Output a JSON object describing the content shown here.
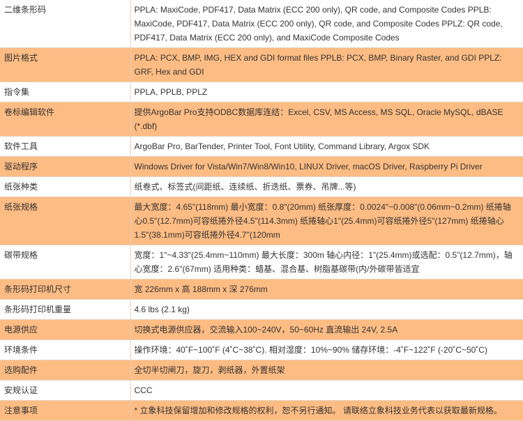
{
  "rows": [
    {
      "label": "二维条形码",
      "value": "PPLA: MaxiCode, PDF417, Data Matrix (ECC 200 only), QR code, and Composite Codes PPLB: MaxiCode, PDF417, Data Matrix (ECC 200 only), QR code, and Composite Codes PPLZ: QR code, PDF417, Data Matrix (ECC 200 only), and MaxiCode Composite Codes"
    },
    {
      "label": "图片格式",
      "value": "PPLA: PCX, BMP, IMG, HEX and GDI format files PPLB: PCX, BMP, Binary Raster, and GDI PPLZ: GRF, Hex and GDI"
    },
    {
      "label": "指令集",
      "value": "PPLA, PPLB, PPLZ"
    },
    {
      "label": "卷标编辑软件",
      "value": "提供ArgoBar Pro支持ODBC数据库连结：Excel, CSV, MS Access, MS SQL, Oracle MySQL, dBASE (*.dbf)"
    },
    {
      "label": "软件工具",
      "value": "ArgoBar Pro, BarTender, Printer Tool, Font Utility, Command Library, Argox SDK"
    },
    {
      "label": "驱动程序",
      "value": "Windows Driver for Vista/Win7/Win8/Win10, LINUX Driver, macOS Driver, Raspberry Pi Driver"
    },
    {
      "label": "纸张种类",
      "value": "纸卷式、标签式(间距纸、连续纸、折迭纸、票券、吊牌...等)"
    },
    {
      "label": "纸张规格",
      "value": "最大宽度：4.65\"(118mm) 最小宽度：0.8\"(20mm) 纸张厚度：0.0024\"~0.008\"(0.06mm~0.2mm) 纸捲轴心0.5\"(12.7mm)可容纸捲外径4.5\"(114.3mm) 纸捲轴心1\"(25.4mm)可容纸捲外径5\"(127mm) 纸捲轴心1.5\"(38.1mm)可容纸捲外径4.7\"(120mm"
    },
    {
      "label": "碳带规格",
      "value": "宽度：1\"~4.33\"(25.4mm~110mm) 最大长度：300m 轴心内径：1\"(25.4mm)或选配：0.5\"(12.7mm)，轴心宽度：2.6\"(67mm) 适用种类：蜡基、混合基、树脂基碳带(内/外碳带皆适宜"
    },
    {
      "label": "条形码打印机尺寸",
      "value": "宽 226mm x 高 188mm x 深 276mm"
    },
    {
      "label": "条形码打印机重量",
      "value": "4.6 lbs (2.1 kg)"
    },
    {
      "label": "电源供应",
      "value": "切换式电源供应器，交流输入100~240V，50~60Hz 直流输出 24V, 2.5A"
    },
    {
      "label": "环境条件",
      "value": "操作环境：40˚F~100˚F (4˚C~38˚C). 相对湿度：10%~90% 储存环境：-4˚F~122˚F (-20˚C~50˚C)"
    },
    {
      "label": "选购配件",
      "value": "全切半切闸刀，旋刀，剥纸器，外置纸架"
    },
    {
      "label": "安规认证",
      "value": "CCC"
    },
    {
      "label": "注意事项",
      "value": "* 立象科技保留增加和修改规格的权利，恕不另行通知。 请联络立象科技业务代表以获取最新规格。"
    }
  ]
}
